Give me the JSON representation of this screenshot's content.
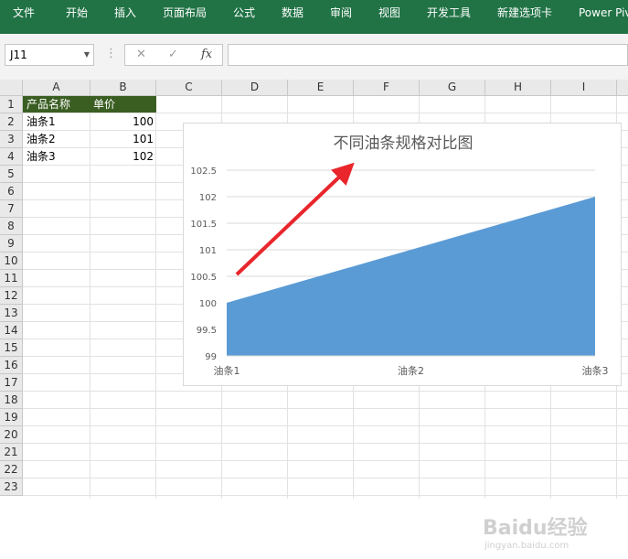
{
  "ribbon": {
    "tabs": [
      "文件",
      "开始",
      "插入",
      "页面布局",
      "公式",
      "数据",
      "审阅",
      "视图",
      "开发工具",
      "新建选项卡",
      "Power Piv"
    ]
  },
  "formula_bar": {
    "name_box": "J11",
    "fx_label": "fx",
    "formula": ""
  },
  "sheet": {
    "columns": [
      "A",
      "B",
      "C",
      "D",
      "E",
      "F",
      "G",
      "H",
      "I"
    ],
    "rows": [
      "1",
      "2",
      "3",
      "4",
      "5",
      "6",
      "7",
      "8",
      "9",
      "10",
      "11",
      "12",
      "13",
      "14",
      "15",
      "16",
      "17",
      "18",
      "19",
      "20",
      "21",
      "22",
      "23"
    ],
    "table": {
      "headers": [
        "产品名称",
        "单价"
      ],
      "rows": [
        [
          "油条1",
          "100"
        ],
        [
          "油条2",
          "101"
        ],
        [
          "油条3",
          "102"
        ]
      ]
    }
  },
  "chart_data": {
    "type": "area",
    "title": "不同油条规格对比图",
    "categories": [
      "油条1",
      "油条2",
      "油条3"
    ],
    "series": [
      {
        "values": [
          100,
          101,
          102
        ],
        "color": "#5b9bd5"
      }
    ],
    "ylim": [
      99,
      102.5
    ],
    "yticks": [
      "99",
      "99.5",
      "100",
      "100.5",
      "101",
      "101.5",
      "102",
      "102.5"
    ],
    "grid": true,
    "annotation": "red arrow"
  },
  "watermark": {
    "text": "Baidu经验",
    "subtext": "jingyan.baidu.com"
  },
  "colors": {
    "ribbon": "#217346",
    "header_fill": "#3a5e22",
    "area": "#5b9bd5",
    "arrow": "#e8262c"
  }
}
